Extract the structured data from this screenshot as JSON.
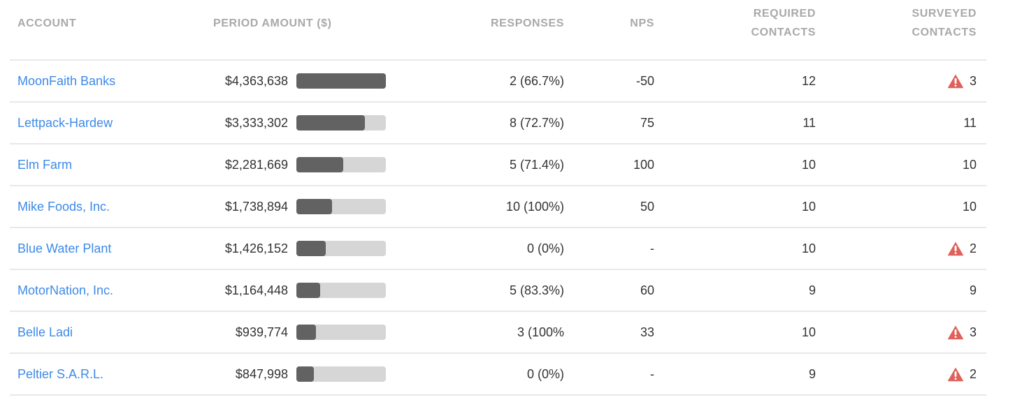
{
  "columns": {
    "account": "ACCOUNT",
    "period_amount": "PERIOD AMOUNT ($)",
    "responses": "RESPONSES",
    "nps": "NPS",
    "required_line1": "REQUIRED",
    "required_line2": "CONTACTS",
    "surveyed_line1": "SURVEYED",
    "surveyed_line2": "CONTACTS"
  },
  "colors": {
    "link": "#3d8ae8",
    "bar_fill": "#626262",
    "bar_track": "#d6d6d6",
    "warning": "#e0605a"
  },
  "rows": [
    {
      "account": "MoonFaith Banks",
      "amount": "$4,363,638",
      "amount_value": 4363638,
      "bar_fraction": 1.0,
      "responses": "2 (66.7%)",
      "nps": "-50",
      "required": "12",
      "surveyed": "3",
      "warning": true
    },
    {
      "account": "Lettpack-Hardew",
      "amount": "$3,333,302",
      "amount_value": 3333302,
      "bar_fraction": 0.764,
      "responses": "8 (72.7%)",
      "nps": "75",
      "required": "11",
      "surveyed": "11",
      "warning": false
    },
    {
      "account": "Elm Farm",
      "amount": "$2,281,669",
      "amount_value": 2281669,
      "bar_fraction": 0.523,
      "responses": "5 (71.4%)",
      "nps": "100",
      "required": "10",
      "surveyed": "10",
      "warning": false
    },
    {
      "account": "Mike Foods, Inc.",
      "amount": "$1,738,894",
      "amount_value": 1738894,
      "bar_fraction": 0.398,
      "responses": "10 (100%)",
      "nps": "50",
      "required": "10",
      "surveyed": "10",
      "warning": false
    },
    {
      "account": "Blue Water Plant",
      "amount": "$1,426,152",
      "amount_value": 1426152,
      "bar_fraction": 0.327,
      "responses": "0 (0%)",
      "nps": "-",
      "required": "10",
      "surveyed": "2",
      "warning": true
    },
    {
      "account": "MotorNation, Inc.",
      "amount": "$1,164,448",
      "amount_value": 1164448,
      "bar_fraction": 0.267,
      "responses": "5 (83.3%)",
      "nps": "60",
      "required": "9",
      "surveyed": "9",
      "warning": false
    },
    {
      "account": "Belle Ladi",
      "amount": "$939,774",
      "amount_value": 939774,
      "bar_fraction": 0.215,
      "responses": "3 (100%",
      "nps": "33",
      "required": "10",
      "surveyed": "3",
      "warning": true
    },
    {
      "account": "Peltier S.A.R.L.",
      "amount": "$847,998",
      "amount_value": 847998,
      "bar_fraction": 0.194,
      "responses": "0 (0%)",
      "nps": "-",
      "required": "9",
      "surveyed": "2",
      "warning": true
    }
  ]
}
